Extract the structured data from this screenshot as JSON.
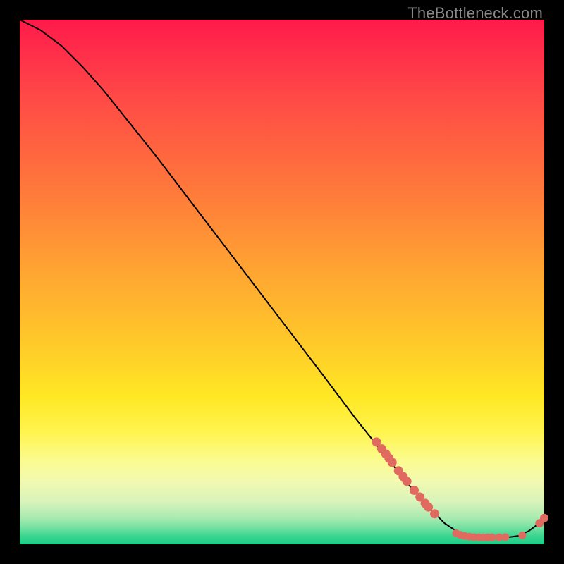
{
  "watermark": "TheBottleneck.com",
  "colors": {
    "curve_stroke": "#000000",
    "marker_fill": "#e06a60",
    "marker_stroke": "#e06a60",
    "gradient_top": "#ff1a4a",
    "gradient_bottom": "#1fce87"
  },
  "chart_data": {
    "type": "line",
    "title": "",
    "xlabel": "",
    "ylabel": "",
    "xlim": [
      0,
      100
    ],
    "ylim": [
      0,
      100
    ],
    "grid": false,
    "legend": false,
    "curve": [
      {
        "x": 0,
        "y": 100
      },
      {
        "x": 4,
        "y": 98
      },
      {
        "x": 8,
        "y": 95
      },
      {
        "x": 12,
        "y": 91
      },
      {
        "x": 16,
        "y": 86.5
      },
      {
        "x": 20,
        "y": 81.5
      },
      {
        "x": 26,
        "y": 74
      },
      {
        "x": 34,
        "y": 63.5
      },
      {
        "x": 42,
        "y": 53
      },
      {
        "x": 50,
        "y": 42.5
      },
      {
        "x": 58,
        "y": 32
      },
      {
        "x": 64,
        "y": 24
      },
      {
        "x": 70,
        "y": 16.5
      },
      {
        "x": 74,
        "y": 11.5
      },
      {
        "x": 78,
        "y": 7
      },
      {
        "x": 81,
        "y": 4
      },
      {
        "x": 84,
        "y": 2
      },
      {
        "x": 87,
        "y": 1.3
      },
      {
        "x": 90,
        "y": 1.3
      },
      {
        "x": 93,
        "y": 1.3
      },
      {
        "x": 95,
        "y": 1.6
      },
      {
        "x": 97,
        "y": 2.5
      },
      {
        "x": 98.5,
        "y": 3.6
      },
      {
        "x": 100,
        "y": 5
      }
    ],
    "markers_upper": [
      {
        "x": 68,
        "y": 19.5
      },
      {
        "x": 69,
        "y": 18.2
      },
      {
        "x": 69.8,
        "y": 17.2
      },
      {
        "x": 70.4,
        "y": 16.4
      },
      {
        "x": 71,
        "y": 15.6
      },
      {
        "x": 72.2,
        "y": 14.0
      },
      {
        "x": 73.1,
        "y": 12.9
      },
      {
        "x": 73.8,
        "y": 12.0
      },
      {
        "x": 75.2,
        "y": 10.3
      },
      {
        "x": 76.3,
        "y": 9.0
      },
      {
        "x": 77.3,
        "y": 7.8
      },
      {
        "x": 77.9,
        "y": 7.1
      },
      {
        "x": 79.1,
        "y": 5.8
      }
    ],
    "markers_lower": [
      {
        "x": 83.2,
        "y": 2.1
      },
      {
        "x": 84.0,
        "y": 1.8
      },
      {
        "x": 84.8,
        "y": 1.6
      },
      {
        "x": 85.7,
        "y": 1.45
      },
      {
        "x": 86.6,
        "y": 1.35
      },
      {
        "x": 87.6,
        "y": 1.3
      },
      {
        "x": 88.4,
        "y": 1.3
      },
      {
        "x": 89.3,
        "y": 1.3
      },
      {
        "x": 90.1,
        "y": 1.3
      },
      {
        "x": 91.4,
        "y": 1.3
      },
      {
        "x": 92.6,
        "y": 1.35
      },
      {
        "x": 95.8,
        "y": 1.7
      }
    ],
    "markers_tail": [
      {
        "x": 99.1,
        "y": 4.0
      },
      {
        "x": 100.0,
        "y": 5.0
      }
    ]
  }
}
